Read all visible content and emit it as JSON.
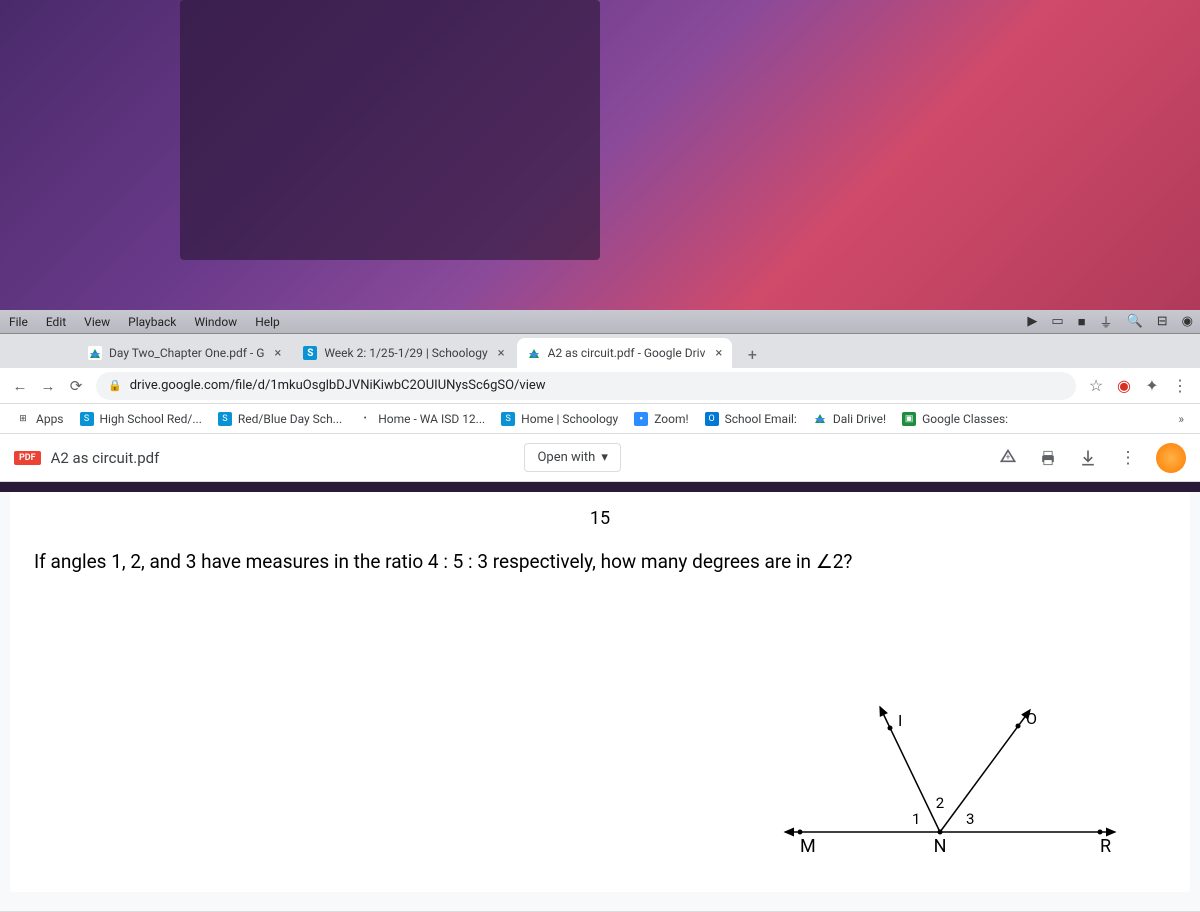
{
  "mac_menu": [
    "File",
    "Edit",
    "View",
    "Playback",
    "Window",
    "Help"
  ],
  "tabs": [
    {
      "label": "Day Two_Chapter One.pdf - G",
      "type": "drive"
    },
    {
      "label": "Week 2: 1/25-1/29 | Schoology",
      "type": "schoology"
    },
    {
      "label": "A2 as circuit.pdf - Google Driv",
      "type": "drive",
      "active": true
    }
  ],
  "url": "drive.google.com/file/d/1mkuOsglbDJVNiKiwbC2OUIUNysSc6gSO/view",
  "bookmarks": [
    {
      "label": "Apps",
      "icon": "grid"
    },
    {
      "label": "High School Red/...",
      "icon": "s"
    },
    {
      "label": "Red/Blue Day Sch...",
      "icon": "s"
    },
    {
      "label": "Home - WA ISD 12...",
      "icon": "dot"
    },
    {
      "label": "Home | Schoology",
      "icon": "s"
    },
    {
      "label": "Zoom!",
      "icon": "zoom"
    },
    {
      "label": "School Email:",
      "icon": "o"
    },
    {
      "label": "Dali Drive!",
      "icon": "drive"
    },
    {
      "label": "Google Classes:",
      "icon": "class"
    }
  ],
  "drive_bar": {
    "badge": "PDF",
    "title": "A2 as circuit.pdf",
    "open_with": "Open with"
  },
  "document": {
    "problem_number": "15",
    "question": "If angles 1, 2, and 3 have measures in the ratio 4 : 5 : 3 respectively, how many degrees are in ∠2?",
    "labels": {
      "M": "M",
      "N": "N",
      "R": "R",
      "I": "I",
      "O": "O",
      "a1": "1",
      "a2": "2",
      "a3": "3"
    }
  }
}
